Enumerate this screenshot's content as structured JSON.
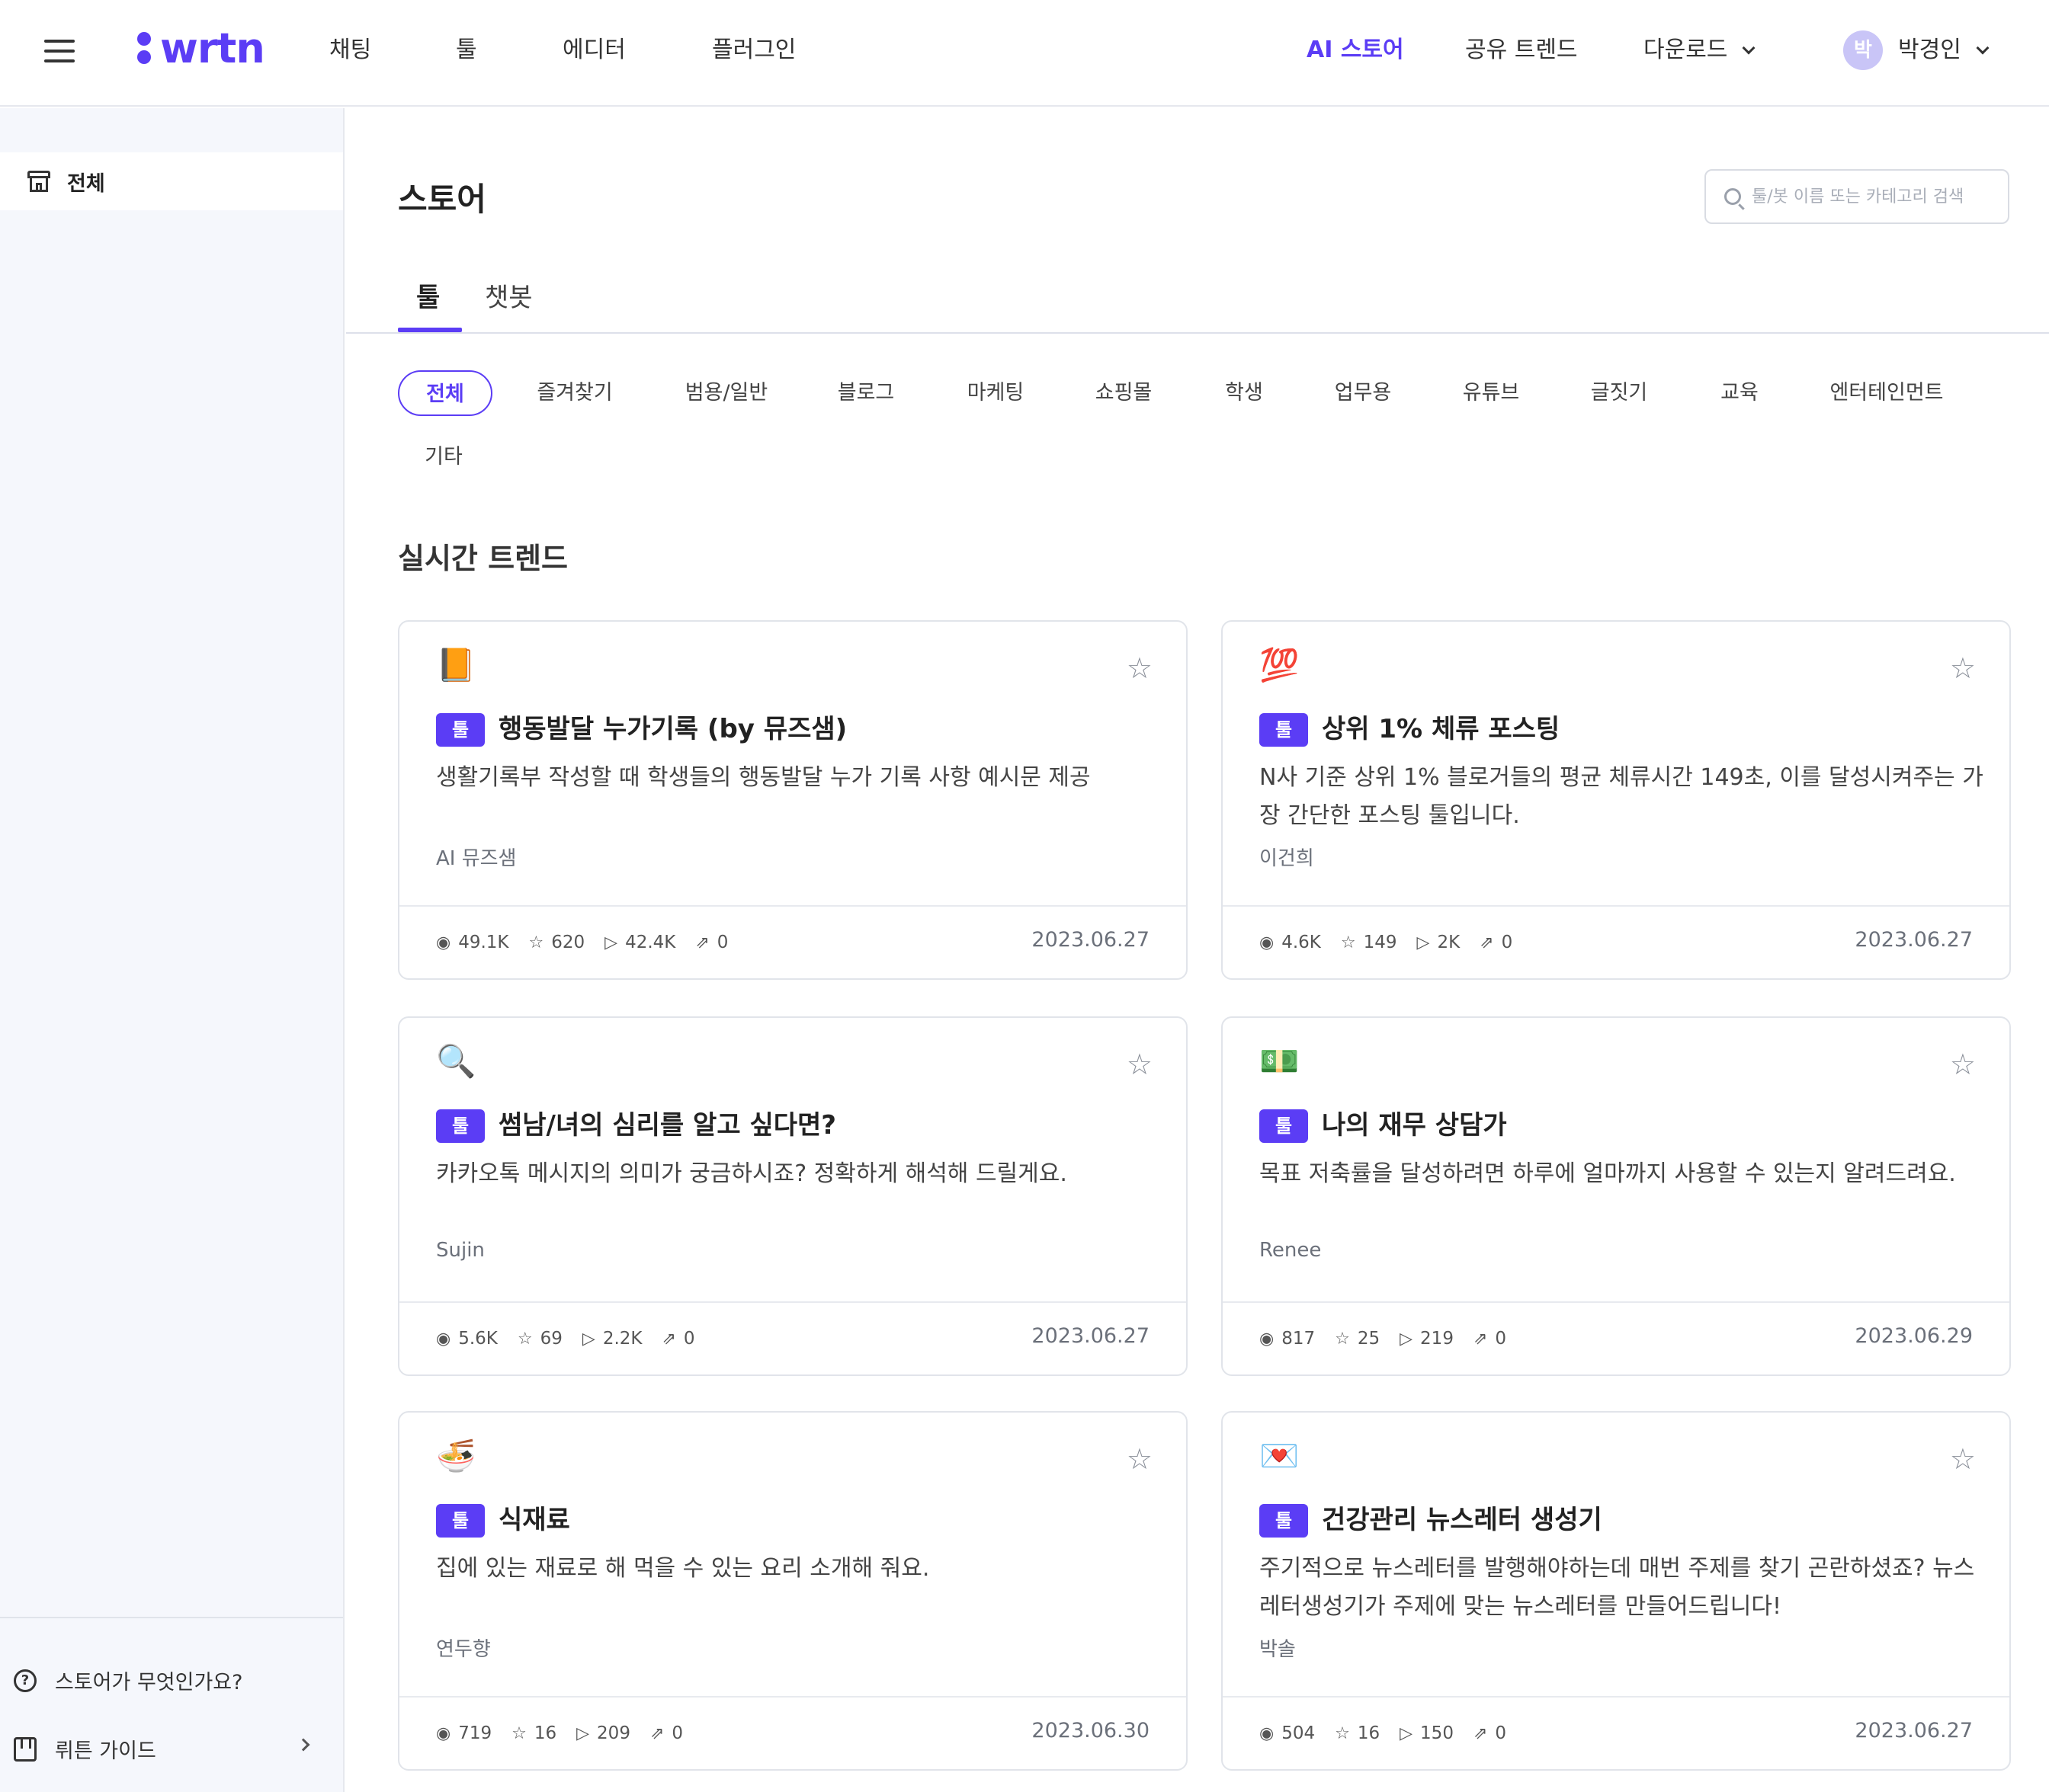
{
  "app": {
    "logo_text": "wrtn",
    "brand_color": "#5b3df5"
  },
  "nav": {
    "left": [
      "채팅",
      "툴",
      "에디터",
      "플러그인"
    ],
    "ai_store": "AI 스토어",
    "trend": "공유 트렌드",
    "download": "다운로드",
    "user_initial": "박",
    "user_name": "박경인"
  },
  "sidebar": {
    "item": "전체",
    "what_is_store": "스토어가 무엇인가요?",
    "guide": "뤼튼 가이드"
  },
  "page": {
    "title": "스토어",
    "search_placeholder": "툴/봇 이름 또는 카테고리 검색",
    "tabs": [
      "툴",
      "챗봇"
    ],
    "chips": [
      "전체",
      "즐겨찾기",
      "범용/일반",
      "블로그",
      "마케팅",
      "쇼핑몰",
      "학생",
      "업무용",
      "유튜브",
      "글짓기",
      "교육",
      "엔터테인먼트",
      "기타"
    ],
    "section_title": "실시간 트렌드"
  },
  "cards": [
    {
      "emoji": "📙",
      "badge": "툴",
      "title": "행동발달 누가기록 (by 뮤즈샘)",
      "desc": "생활기록부 작성할 때 학생들의 행동발달 누가 기록 사항 예시문 제공",
      "author": "AI 뮤즈샘",
      "views": "49.1K",
      "stars": "620",
      "runs": "42.4K",
      "shares": "0",
      "date": "2023.06.27"
    },
    {
      "emoji": "💯",
      "badge": "툴",
      "title": "상위 1% 체류 포스팅",
      "desc": "N사 기준 상위 1% 블로거들의 평균 체류시간 149초, 이를 달성시켜주는 가장 간단한 포스팅 툴입니다.",
      "author": "이건희",
      "views": "4.6K",
      "stars": "149",
      "runs": "2K",
      "shares": "0",
      "date": "2023.06.27"
    },
    {
      "emoji": "🔍",
      "badge": "툴",
      "title": "썸남/녀의 심리를 알고 싶다면?",
      "desc": "카카오톡 메시지의 의미가 궁금하시죠? 정확하게 해석해 드릴게요.",
      "author": "Sujin",
      "views": "5.6K",
      "stars": "69",
      "runs": "2.2K",
      "shares": "0",
      "date": "2023.06.27"
    },
    {
      "emoji": "💵",
      "badge": "툴",
      "title": "나의 재무 상담가",
      "desc": "목표 저축률을 달성하려면 하루에 얼마까지 사용할 수 있는지 알려드려요.",
      "author": "Renee",
      "views": "817",
      "stars": "25",
      "runs": "219",
      "shares": "0",
      "date": "2023.06.29"
    },
    {
      "emoji": "🍜",
      "badge": "툴",
      "title": "식재료",
      "desc": "집에 있는 재료로 해 먹을 수 있는 요리 소개해 줘요.",
      "author": "연두향",
      "views": "719",
      "stars": "16",
      "runs": "209",
      "shares": "0",
      "date": "2023.06.30"
    },
    {
      "emoji": "💌",
      "badge": "툴",
      "title": "건강관리 뉴스레터 생성기",
      "desc": "주기적으로 뉴스레터를 발행해야하는데 매번 주제를 찾기 곤란하셨죠? 뉴스레터생성기가 주제에 맞는 뉴스레터를 만들어드립니다!",
      "author": "박솔",
      "views": "504",
      "stars": "16",
      "runs": "150",
      "shares": "0",
      "date": "2023.06.27"
    }
  ]
}
